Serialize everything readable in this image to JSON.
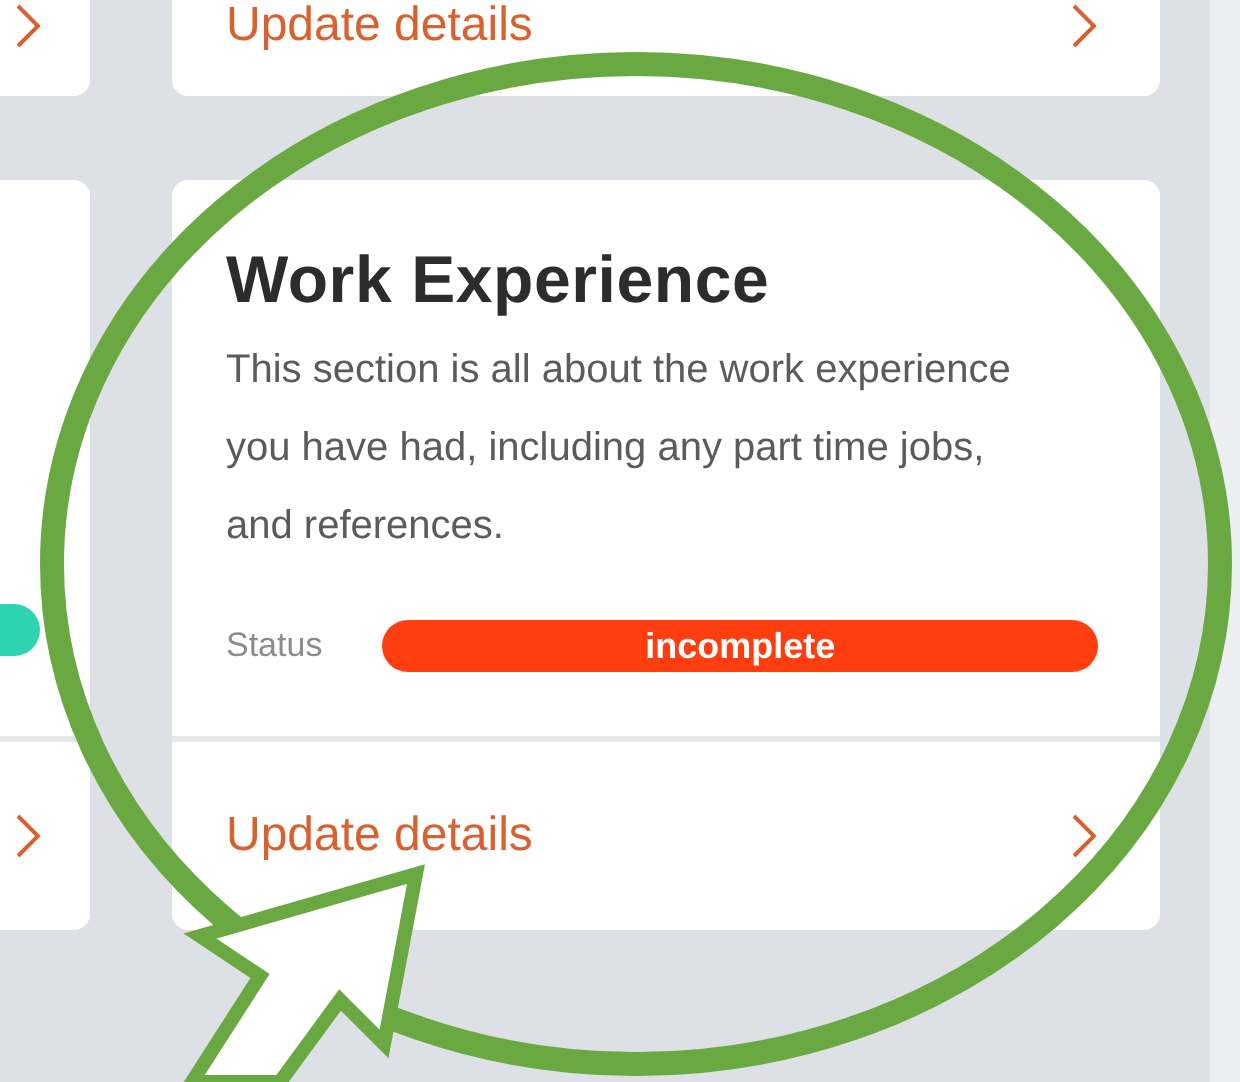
{
  "top_row": [
    {
      "kind": "cut"
    },
    {
      "kind": "link",
      "link": "Update details"
    }
  ],
  "main_row": [
    {
      "kind": "cut",
      "color": "#2ed3b0"
    },
    {
      "kind": "card",
      "title": "Work Experience",
      "description": "This section is all about the work experience you have had, including any part time jobs, and references.",
      "status_label": "Status",
      "status": "incomplete",
      "color": "#ff3d0f",
      "link": "Update details"
    }
  ]
}
